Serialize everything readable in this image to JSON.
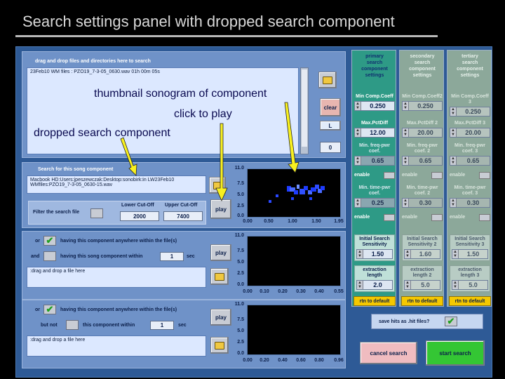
{
  "slide": {
    "title": "Search settings panel with dropped search component"
  },
  "top_section": {
    "header": "drag and drop files and directories here to search",
    "file_line": "23Feb10 WM files :   PZO19_7-3-05_0630.wav    01h 00m 05s",
    "clear_label": "clear",
    "l_label": "L",
    "count_value": "0"
  },
  "song_section": {
    "header": "Search for this song component",
    "path_line1": "Macbook HD:Users:jpeszewczak:Desktop:sonobirk:in LW23Feb10",
    "path_line2": "WMfiles:PZO19_7-3-05_0630-15.wav",
    "filter_label": "Filter the search file",
    "lower_label": "Lower Cut-Off",
    "upper_label": "Upper Cut-Off",
    "lower_value": "2000",
    "upper_value": "7400",
    "play_label": "play",
    "y_ticks": [
      "11.0",
      "7.5",
      "5.0",
      "2.5",
      "0.0"
    ],
    "x_ticks": [
      "0.00",
      "0.50",
      "1.00",
      "1.50",
      "1.95"
    ]
  },
  "second_section": {
    "or_label": "or",
    "anywhere_label": "having this component anywhere within the file(s)",
    "and_label": "and",
    "within_label": "having this song component within",
    "within_value": "1",
    "sec_label": "sec",
    "drop_label": ":drag and drop a file here",
    "play_label": "play",
    "y_ticks": [
      "11.0",
      "7.5",
      "5.0",
      "2.5",
      "0.0"
    ],
    "x_ticks": [
      "0.00",
      "0.10",
      "0.20",
      "0.30",
      "0.40",
      "0.55"
    ]
  },
  "third_section": {
    "or_label": "or",
    "anywhere_label": "having this component anywhere within the file(s)",
    "but_not_label": "but not",
    "within_label": "this component within",
    "within_value": "1",
    "sec_label": "sec",
    "drop_label": ":drag and drop a file here",
    "play_label": "play",
    "y_ticks": [
      "11.0",
      "7.5",
      "5.0",
      "2.5",
      "0.0"
    ],
    "x_ticks": [
      "0.00",
      "0.20",
      "0.40",
      "0.60",
      "0.80",
      "0.96"
    ]
  },
  "columns": [
    {
      "head": [
        "primary",
        "search",
        "component",
        "settings"
      ],
      "min_coeff_label": "Min Comp.Coeff",
      "min_coeff_value": "0.250",
      "max_pct_label": "Max.PctDiff",
      "max_pct_value": "12.00",
      "min_freq_label": "Min. freq-pwr coef.",
      "min_freq_value": "0.65",
      "min_time_label": "Min. time-pwr coef.",
      "min_time_value": "0.25",
      "sens_label": "Initial Search Sensitivity",
      "sens_value": "1.50",
      "extract_label": "extraction length",
      "extract_value": "2.0",
      "enable_label": "enable",
      "rtd_label": "rtn to default"
    },
    {
      "head": [
        "secondary",
        "search",
        "component",
        "settings"
      ],
      "min_coeff_label": "Min Comp.Coeff2",
      "min_coeff_value": "0.250",
      "max_pct_label": "Max.PctDiff 2",
      "max_pct_value": "20.00",
      "min_freq_label": "Min. freq-pwr coef. 2",
      "min_freq_value": "0.65",
      "min_time_label": "Min. time-pwr coef. 2",
      "min_time_value": "0.30",
      "sens_label": "Initial Search Sensitivity 2",
      "sens_value": "1.60",
      "extract_label": "extraction length 2",
      "extract_value": "5.0",
      "enable_label": "enable",
      "rtd_label": "rtn to default"
    },
    {
      "head": [
        "tertiary",
        "search",
        "component",
        "settings"
      ],
      "min_coeff_label": "Min Comp.Coeff 3",
      "min_coeff_value": "0.250",
      "max_pct_label": "Max.PctDiff 3",
      "max_pct_value": "20.00",
      "min_freq_label": "Min. freq-pwr coef. 3",
      "min_freq_value": "0.65",
      "min_time_label": "Min. time-pwr coef. 3",
      "min_time_value": "0.30",
      "sens_label": "Initial Search Sensitivity 3",
      "sens_value": "1.50",
      "extract_label": "extraction length 3",
      "extract_value": "5.0",
      "enable_label": "enable",
      "rtd_label": "rtn to default"
    }
  ],
  "bottom": {
    "save_hits_label": "save hits as .hit files?",
    "cancel_label": "cancel search",
    "start_label": "start search"
  },
  "annotations": {
    "thumbnail": "thumbnail sonogram of component",
    "click_to_play": "click to play",
    "dropped": "dropped search component"
  },
  "colors": {
    "col1_bg": "#2e9a86",
    "col2_bg": "#8ca89a",
    "col3_bg": "#8ca89a",
    "arrow": "#f8f020",
    "start_green": "#34c634"
  }
}
